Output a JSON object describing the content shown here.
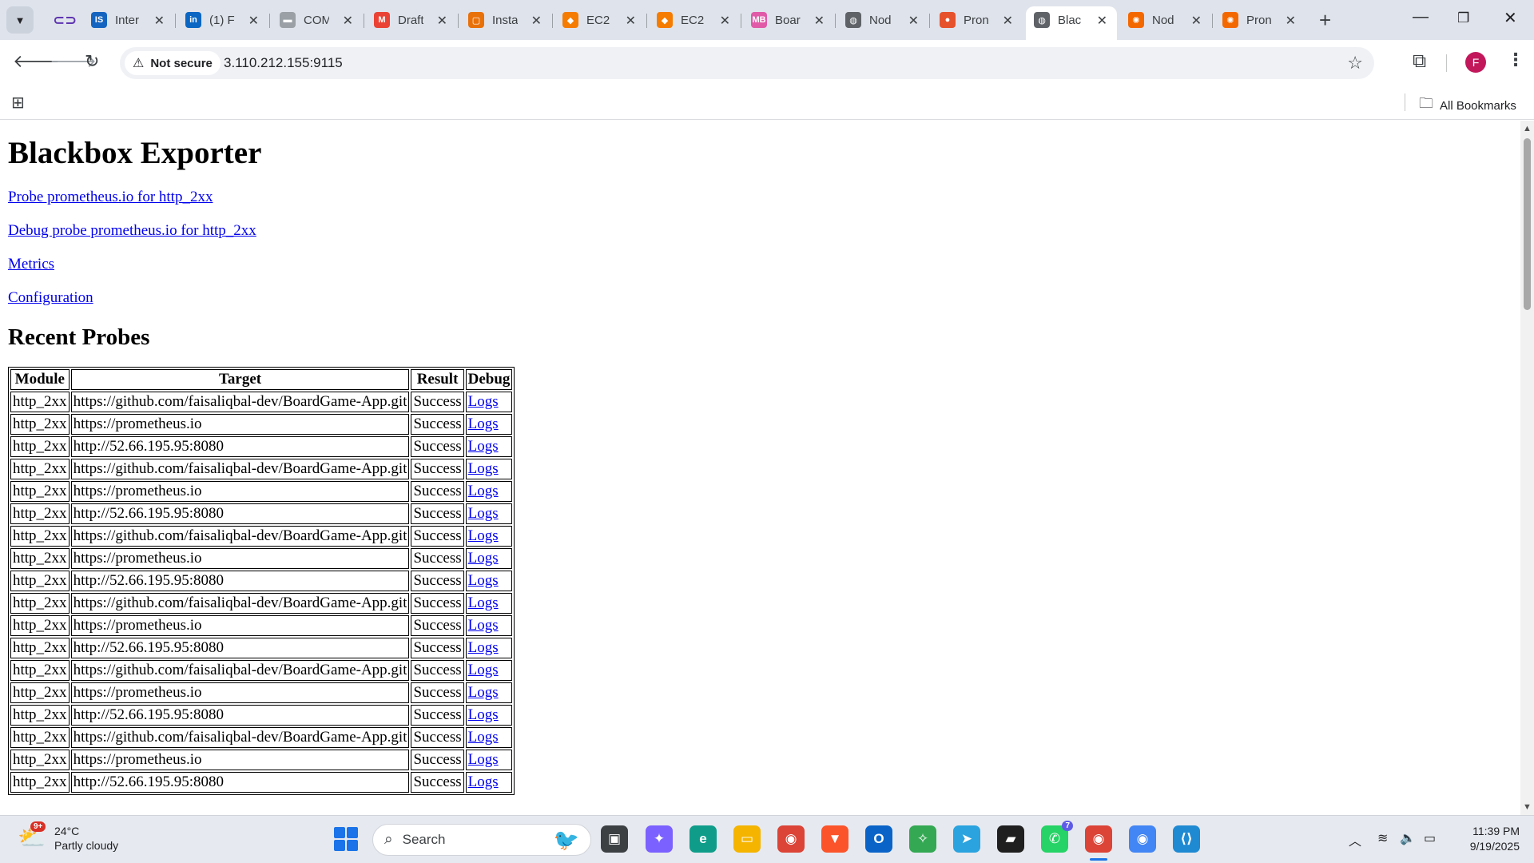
{
  "browser": {
    "tabs": [
      {
        "title": "Inter",
        "icon": "is-logo-icon",
        "color": "#1565c0",
        "glyph": "IS"
      },
      {
        "title": "(1) F",
        "icon": "linkedin-icon",
        "color": "#0a66c2",
        "glyph": "in"
      },
      {
        "title": "COM",
        "icon": "generic-page-icon",
        "color": "#9aa0a6",
        "glyph": "▬"
      },
      {
        "title": "Draft",
        "icon": "gmail-icon",
        "color": "#ea4335",
        "glyph": "M"
      },
      {
        "title": "Insta",
        "icon": "instance-icon",
        "color": "#e8710a",
        "glyph": "▢"
      },
      {
        "title": "EC2",
        "icon": "ec2-icon",
        "color": "#f57c00",
        "glyph": "◆"
      },
      {
        "title": "EC2",
        "icon": "ec2-icon",
        "color": "#f57c00",
        "glyph": "◆"
      },
      {
        "title": "Boar",
        "icon": "mb-logo-icon",
        "color": "#e05aa8",
        "glyph": "MB"
      },
      {
        "title": "Nod",
        "icon": "globe-icon",
        "color": "#5f6368",
        "glyph": "◍"
      },
      {
        "title": "Pron",
        "icon": "prometheus-icon",
        "color": "#e6522c",
        "glyph": "●"
      },
      {
        "title": "Blac",
        "icon": "globe-icon",
        "color": "#5f6368",
        "glyph": "◍",
        "active": true
      },
      {
        "title": "Nod",
        "icon": "grafana-icon",
        "color": "#f46800",
        "glyph": "✺"
      },
      {
        "title": "Pron",
        "icon": "grafana-icon",
        "color": "#f46800",
        "glyph": "✺"
      }
    ],
    "security_label": "Not secure",
    "url": "3.110.212.155:9115",
    "profile_initial": "F",
    "all_bookmarks": "All Bookmarks"
  },
  "page": {
    "title": "Blackbox Exporter",
    "links": [
      "Probe prometheus.io for http_2xx",
      "Debug probe prometheus.io for http_2xx",
      "Metrics",
      "Configuration"
    ],
    "recent_heading": "Recent Probes",
    "table": {
      "headers": [
        "Module",
        "Target",
        "Result",
        "Debug"
      ],
      "rows": [
        [
          "http_2xx",
          "https://github.com/faisaliqbal-dev/BoardGame-App.git",
          "Success",
          "Logs"
        ],
        [
          "http_2xx",
          "https://prometheus.io",
          "Success",
          "Logs"
        ],
        [
          "http_2xx",
          "http://52.66.195.95:8080",
          "Success",
          "Logs"
        ],
        [
          "http_2xx",
          "https://github.com/faisaliqbal-dev/BoardGame-App.git",
          "Success",
          "Logs"
        ],
        [
          "http_2xx",
          "https://prometheus.io",
          "Success",
          "Logs"
        ],
        [
          "http_2xx",
          "http://52.66.195.95:8080",
          "Success",
          "Logs"
        ],
        [
          "http_2xx",
          "https://github.com/faisaliqbal-dev/BoardGame-App.git",
          "Success",
          "Logs"
        ],
        [
          "http_2xx",
          "https://prometheus.io",
          "Success",
          "Logs"
        ],
        [
          "http_2xx",
          "http://52.66.195.95:8080",
          "Success",
          "Logs"
        ],
        [
          "http_2xx",
          "https://github.com/faisaliqbal-dev/BoardGame-App.git",
          "Success",
          "Logs"
        ],
        [
          "http_2xx",
          "https://prometheus.io",
          "Success",
          "Logs"
        ],
        [
          "http_2xx",
          "http://52.66.195.95:8080",
          "Success",
          "Logs"
        ],
        [
          "http_2xx",
          "https://github.com/faisaliqbal-dev/BoardGame-App.git",
          "Success",
          "Logs"
        ],
        [
          "http_2xx",
          "https://prometheus.io",
          "Success",
          "Logs"
        ],
        [
          "http_2xx",
          "http://52.66.195.95:8080",
          "Success",
          "Logs"
        ],
        [
          "http_2xx",
          "https://github.com/faisaliqbal-dev/BoardGame-App.git",
          "Success",
          "Logs"
        ],
        [
          "http_2xx",
          "https://prometheus.io",
          "Success",
          "Logs"
        ],
        [
          "http_2xx",
          "http://52.66.195.95:8080",
          "Success",
          "Logs"
        ]
      ]
    }
  },
  "taskbar": {
    "weather_temp": "24°C",
    "weather_desc": "Partly cloudy",
    "weather_badge": "9+",
    "search_placeholder": "Search",
    "apps": [
      {
        "name": "copilot-icon",
        "color": "#7b61ff",
        "glyph": "✦"
      },
      {
        "name": "edge-icon",
        "color": "#0f9d8a",
        "glyph": "e"
      },
      {
        "name": "file-explorer-icon",
        "color": "#f4b400",
        "glyph": "▭"
      },
      {
        "name": "chrome-icon",
        "color": "#db4437",
        "glyph": "◉"
      },
      {
        "name": "brave-icon",
        "color": "#fb542b",
        "glyph": "▼"
      },
      {
        "name": "outlook-icon",
        "color": "#0a64c8",
        "glyph": "O"
      },
      {
        "name": "gemini-icon",
        "color": "#34a853",
        "glyph": "✧"
      },
      {
        "name": "telegram-icon",
        "color": "#2aa3df",
        "glyph": "➤"
      },
      {
        "name": "sticky-notes-icon",
        "color": "#1f1f1f",
        "glyph": "▰"
      },
      {
        "name": "whatsapp-icon",
        "color": "#25d366",
        "glyph": "✆",
        "badge": "7"
      },
      {
        "name": "chrome-profile-icon",
        "color": "#db4437",
        "glyph": "◉",
        "active": true
      },
      {
        "name": "chrome-icon",
        "color": "#4285f4",
        "glyph": "◉"
      },
      {
        "name": "vscode-icon",
        "color": "#1f8ad2",
        "glyph": "⟨⟩"
      }
    ],
    "time": "11:39 PM",
    "date": "9/19/2025"
  }
}
